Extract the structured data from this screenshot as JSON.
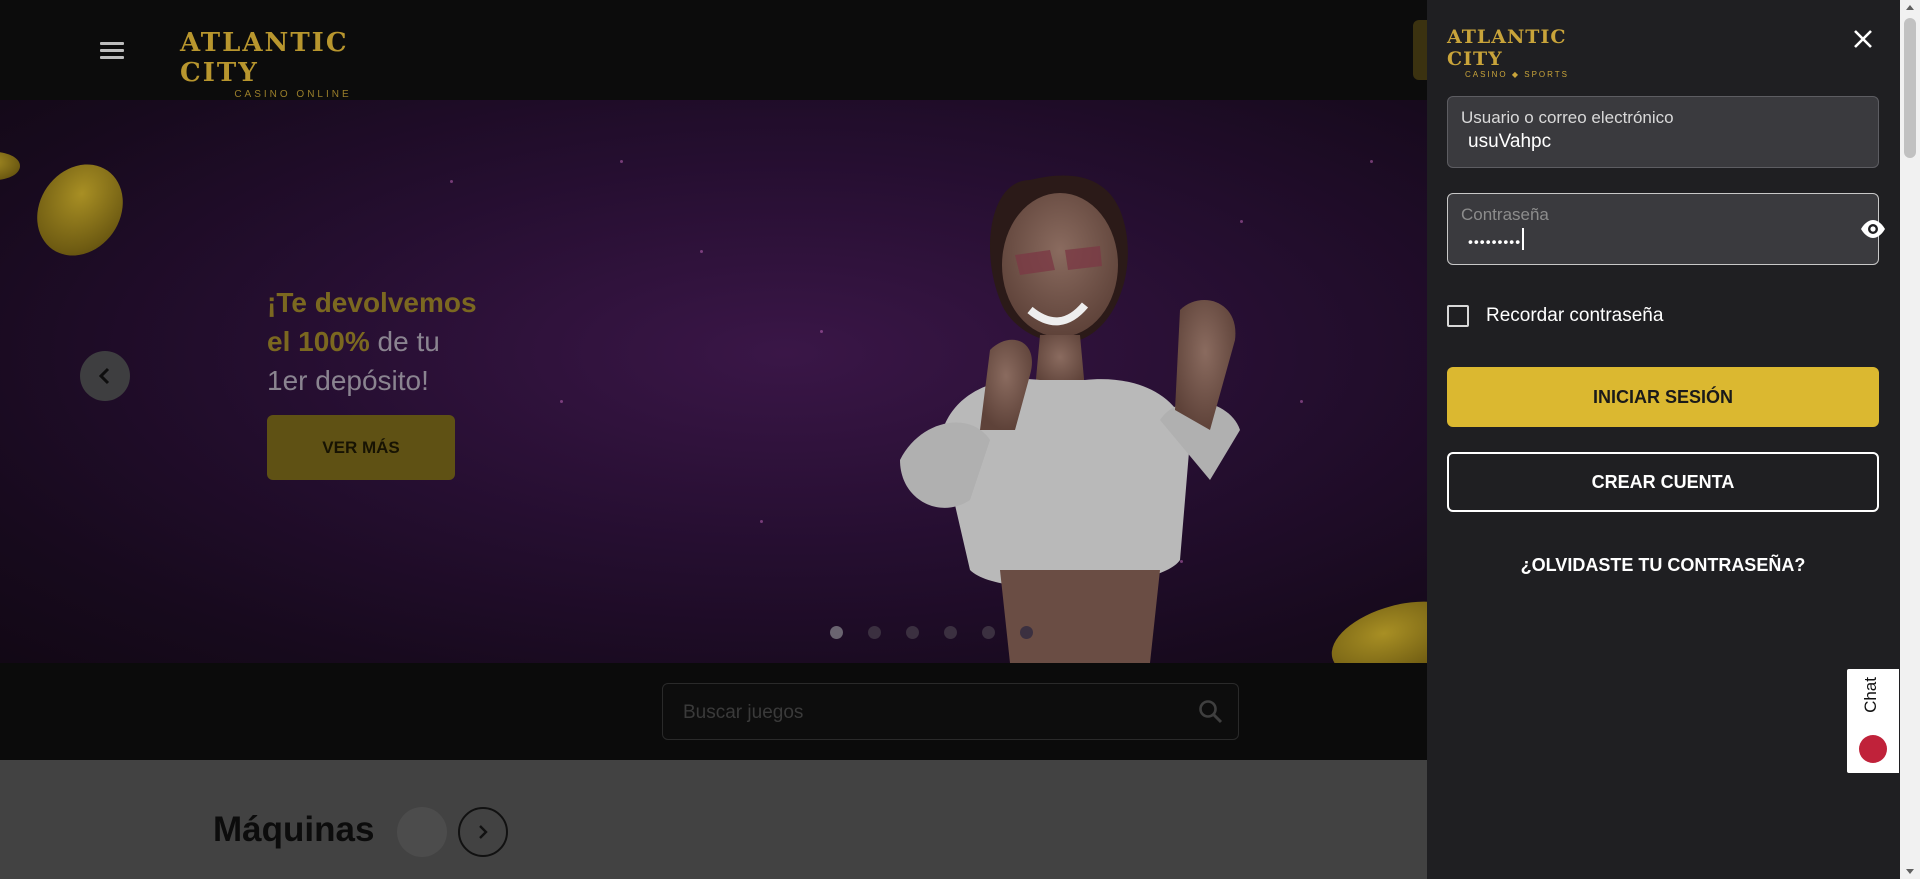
{
  "header": {
    "logo_title": "ATLANTIC CITY",
    "logo_subtitle": "CASINO ONLINE"
  },
  "hero": {
    "headline_highlight_1": "¡Te devolvemos",
    "headline_highlight_2": "el 100%",
    "headline_normal_1": " de tu",
    "headline_normal_2": "1er depósito!",
    "cta_label": "VER MÁS",
    "slide_count": 6,
    "active_slide": 1
  },
  "search": {
    "placeholder": "Buscar juegos"
  },
  "section": {
    "title": "Máquinas"
  },
  "login": {
    "logo_title": "ATLANTIC CITY",
    "logo_subtitle": "CASINO ◆ SPORTS",
    "username_label": "Usuario o correo electrónico",
    "username_value": "usuVahpc",
    "password_label": "Contraseña",
    "password_value": "•••••••••",
    "remember_label": "Recordar contraseña",
    "login_button": "INICIAR SESIÓN",
    "create_button": "CREAR CUENTA",
    "forgot_link": "¿OLVIDASTE TU CONTRASEÑA?"
  },
  "chat": {
    "label": "Chat"
  },
  "colors": {
    "accent_gold": "#dbb830",
    "drawer_bg": "#1f1f22"
  },
  "icons": [
    "menu-icon",
    "chevron-left-icon",
    "search-icon",
    "chevron-right-icon",
    "close-icon",
    "eye-icon",
    "chat-bubble-icon"
  ]
}
